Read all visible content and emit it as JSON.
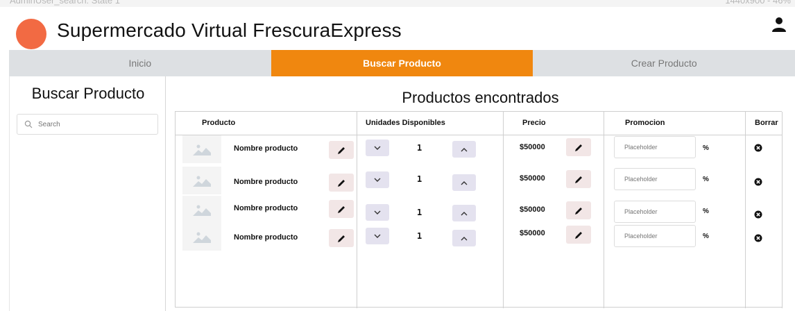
{
  "window": {
    "title_left": "AdminUser_search: State 1",
    "title_right": "1440x900 - 46%"
  },
  "header": {
    "app_title": "Supermercado Virtual FrescuraExpress",
    "logo_color": "#f26a43",
    "user_icon": "user-icon"
  },
  "nav": {
    "tabs": [
      {
        "label": "Inicio",
        "active": false
      },
      {
        "label": "Buscar Producto",
        "active": true
      },
      {
        "label": "Crear Producto",
        "active": false
      }
    ],
    "active_color": "#f0870f"
  },
  "sidebar": {
    "title": "Buscar Producto",
    "search_placeholder": "Search",
    "search_icon": "search-icon"
  },
  "main": {
    "title": "Productos encontrados",
    "columns": [
      "Producto",
      "Unidades Disponibles",
      "Precio",
      "Promocion",
      "Borrar"
    ],
    "rows": [
      {
        "name": "Nombre producto",
        "quantity": "1",
        "price": "$50000",
        "promo_placeholder": "Placeholder",
        "percent": "%"
      },
      {
        "name": "Nombre producto",
        "quantity": "1",
        "price": "$50000",
        "promo_placeholder": "Placeholder",
        "percent": "%"
      },
      {
        "name": "Nombre producto",
        "quantity": "1",
        "price": "$50000",
        "promo_placeholder": "Placeholder",
        "percent": "%"
      },
      {
        "name": "Nombre producto",
        "quantity": "1",
        "price": "$50000",
        "promo_placeholder": "Placeholder",
        "percent": "%"
      }
    ]
  }
}
